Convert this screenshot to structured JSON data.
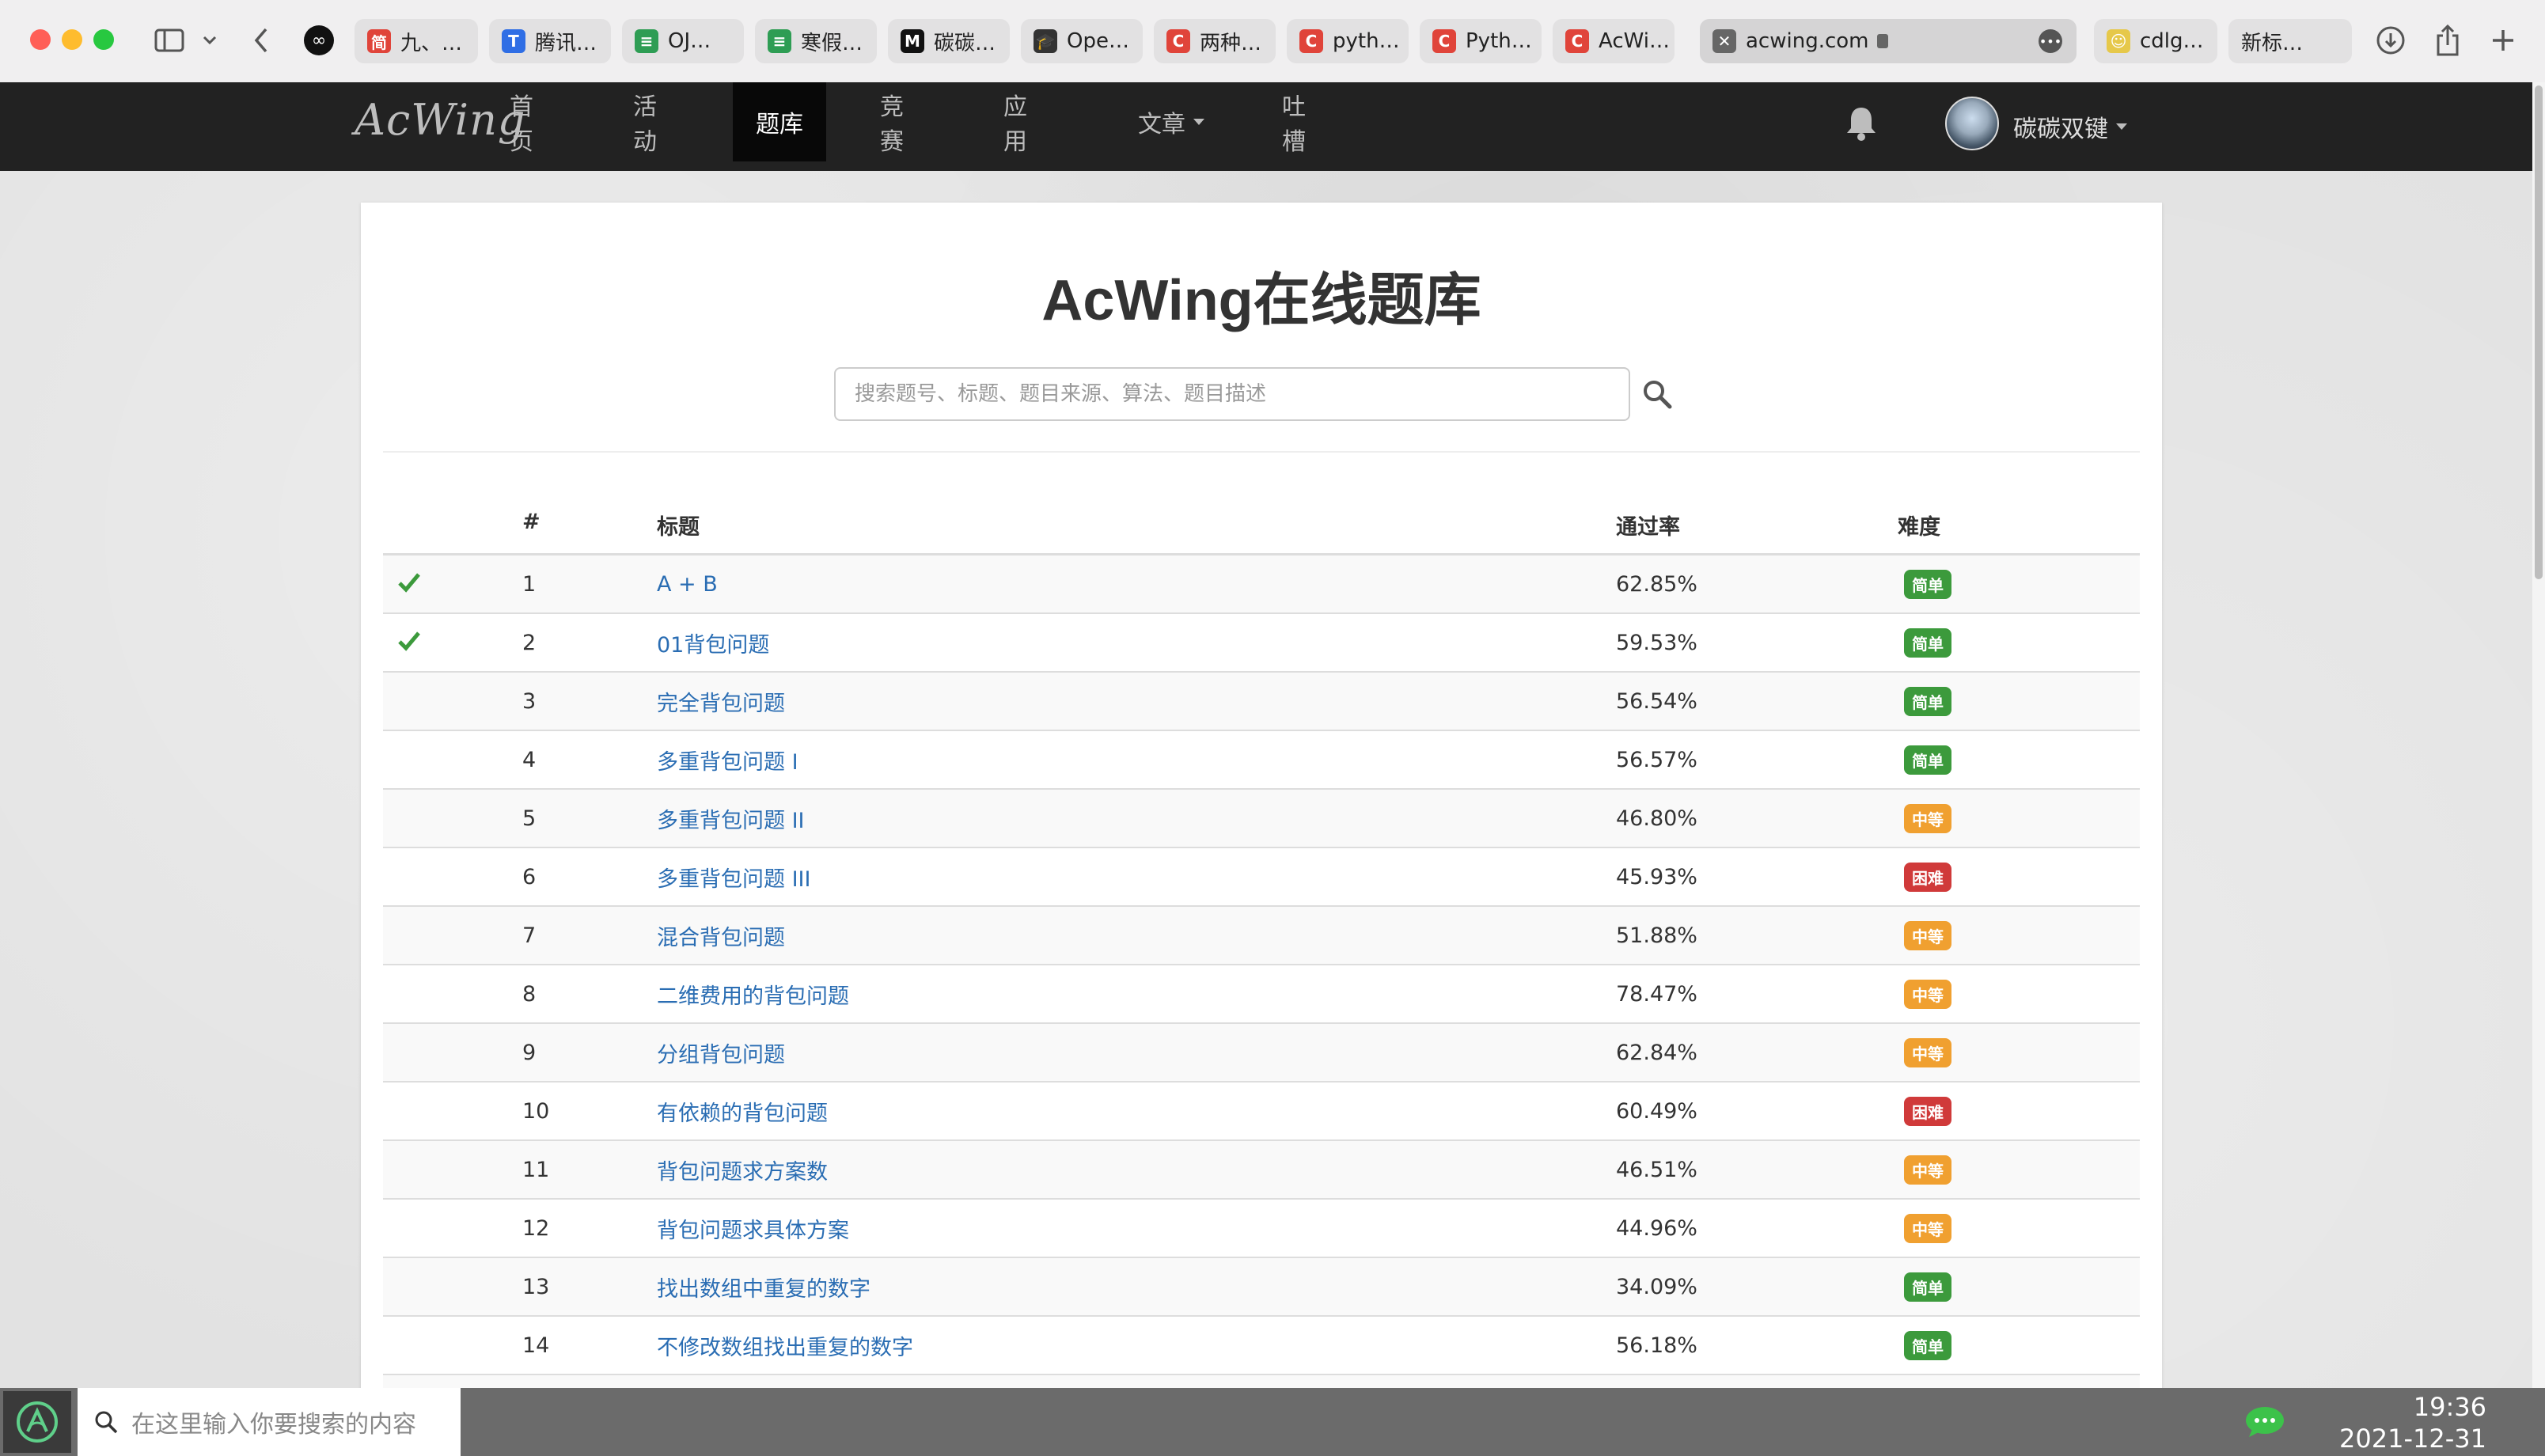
{
  "browser": {
    "tabs": [
      {
        "label": "九、…",
        "color": "#e0443a",
        "glyph": "简"
      },
      {
        "label": "腾讯…",
        "color": "#2f6ee5",
        "glyph": "T"
      },
      {
        "label": "OJ…",
        "color": "#2e9d54",
        "glyph": "≡"
      },
      {
        "label": "寒假…",
        "color": "#2e9d54",
        "glyph": "≡"
      },
      {
        "label": "碳碳…",
        "color": "#111111",
        "glyph": "M"
      },
      {
        "label": "Ope…",
        "color": "#333333",
        "glyph": "🎓"
      },
      {
        "label": "两种…",
        "color": "#e0443a",
        "glyph": "C"
      },
      {
        "label": "pyth…",
        "color": "#e0443a",
        "glyph": "C"
      },
      {
        "label": "Pyth…",
        "color": "#e0443a",
        "glyph": "C"
      },
      {
        "label": "AcWi…",
        "color": "#e0443a",
        "glyph": "C"
      },
      {
        "label": "acwing.com",
        "color": "#666666",
        "glyph": "✕"
      },
      {
        "label": "cdlg…",
        "color": "#e6c84a",
        "glyph": "☺"
      },
      {
        "label": "新标…",
        "color": "#e2e1e2",
        "glyph": ""
      }
    ]
  },
  "site": {
    "logo": "AcWing",
    "nav": [
      {
        "label": "首页"
      },
      {
        "label": "活动"
      },
      {
        "label": "题库",
        "active": true
      },
      {
        "label": "竞赛"
      },
      {
        "label": "应用"
      },
      {
        "label": "文章",
        "dropdown": true
      },
      {
        "label": "吐槽"
      }
    ],
    "username": "碳碳双键"
  },
  "main": {
    "title": "AcWing在线题库",
    "search_placeholder": "搜索题号、标题、题目来源、算法、题目描述",
    "columns": {
      "num": "#",
      "title": "标题",
      "rate": "通过率",
      "difficulty": "难度"
    }
  },
  "problems": [
    {
      "solved": true,
      "id": "1",
      "title": "A + B",
      "rate": "62.85%",
      "difficulty": "简单",
      "level": "easy"
    },
    {
      "solved": true,
      "id": "2",
      "title": "01背包问题",
      "rate": "59.53%",
      "difficulty": "简单",
      "level": "easy"
    },
    {
      "solved": false,
      "id": "3",
      "title": "完全背包问题",
      "rate": "56.54%",
      "difficulty": "简单",
      "level": "easy"
    },
    {
      "solved": false,
      "id": "4",
      "title": "多重背包问题 I",
      "rate": "56.57%",
      "difficulty": "简单",
      "level": "easy"
    },
    {
      "solved": false,
      "id": "5",
      "title": "多重背包问题 II",
      "rate": "46.80%",
      "difficulty": "中等",
      "level": "mid"
    },
    {
      "solved": false,
      "id": "6",
      "title": "多重背包问题 III",
      "rate": "45.93%",
      "difficulty": "困难",
      "level": "hard"
    },
    {
      "solved": false,
      "id": "7",
      "title": "混合背包问题",
      "rate": "51.88%",
      "difficulty": "中等",
      "level": "mid"
    },
    {
      "solved": false,
      "id": "8",
      "title": "二维费用的背包问题",
      "rate": "78.47%",
      "difficulty": "中等",
      "level": "mid"
    },
    {
      "solved": false,
      "id": "9",
      "title": "分组背包问题",
      "rate": "62.84%",
      "difficulty": "中等",
      "level": "mid"
    },
    {
      "solved": false,
      "id": "10",
      "title": "有依赖的背包问题",
      "rate": "60.49%",
      "difficulty": "困难",
      "level": "hard"
    },
    {
      "solved": false,
      "id": "11",
      "title": "背包问题求方案数",
      "rate": "46.51%",
      "difficulty": "中等",
      "level": "mid"
    },
    {
      "solved": false,
      "id": "12",
      "title": "背包问题求具体方案",
      "rate": "44.96%",
      "difficulty": "中等",
      "level": "mid"
    },
    {
      "solved": false,
      "id": "13",
      "title": "找出数组中重复的数字",
      "rate": "34.09%",
      "difficulty": "简单",
      "level": "easy"
    },
    {
      "solved": false,
      "id": "14",
      "title": "不修改数组找出重复的数字",
      "rate": "56.18%",
      "difficulty": "简单",
      "level": "easy"
    }
  ],
  "taskbar": {
    "search_placeholder": "在这里输入你要搜索的内容",
    "time": "19:36",
    "date": "2021-12-31"
  },
  "colors": {
    "navbar": "#222222",
    "link": "#2a6db3",
    "easy": "#3c9a3c",
    "mid": "#f0a030",
    "hard": "#d03a3a",
    "check": "#3c9a3c"
  }
}
